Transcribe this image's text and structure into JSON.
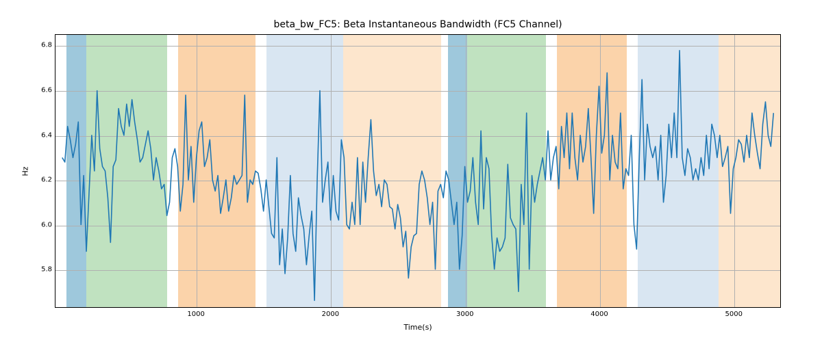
{
  "chart_data": {
    "type": "line",
    "title": "beta_bw_FC5: Beta Instantaneous Bandwidth (FC5 Channel)",
    "xlabel": "Time(s)",
    "ylabel": "Hz",
    "xlim": [
      -50,
      5350
    ],
    "ylim": [
      5.63,
      6.85
    ],
    "xticks": [
      1000,
      2000,
      3000,
      4000,
      5000
    ],
    "yticks": [
      5.8,
      6.0,
      6.2,
      6.4,
      6.6,
      6.8
    ],
    "bands": [
      {
        "x0": 30,
        "x1": 180,
        "color": "#9ec8dc"
      },
      {
        "x0": 180,
        "x1": 780,
        "color": "#c0e2c0"
      },
      {
        "x0": 860,
        "x1": 1440,
        "color": "#fbd3aa"
      },
      {
        "x0": 1520,
        "x1": 2090,
        "color": "#d9e6f2"
      },
      {
        "x0": 2090,
        "x1": 2820,
        "color": "#fde6cd"
      },
      {
        "x0": 2870,
        "x1": 3010,
        "color": "#9ec8dc"
      },
      {
        "x0": 3010,
        "x1": 3600,
        "color": "#c0e2c0"
      },
      {
        "x0": 3680,
        "x1": 4200,
        "color": "#fbd3aa"
      },
      {
        "x0": 4280,
        "x1": 4880,
        "color": "#d9e6f2"
      },
      {
        "x0": 4880,
        "x1": 5350,
        "color": "#fde6cd"
      }
    ],
    "x": [
      0,
      20,
      40,
      60,
      80,
      100,
      120,
      140,
      160,
      180,
      200,
      220,
      240,
      260,
      280,
      300,
      320,
      340,
      360,
      380,
      400,
      420,
      440,
      460,
      480,
      500,
      520,
      540,
      560,
      580,
      600,
      620,
      640,
      660,
      680,
      700,
      720,
      740,
      760,
      780,
      800,
      820,
      840,
      860,
      880,
      900,
      920,
      940,
      960,
      980,
      1000,
      1020,
      1040,
      1060,
      1080,
      1100,
      1120,
      1140,
      1160,
      1180,
      1200,
      1220,
      1240,
      1260,
      1280,
      1300,
      1320,
      1340,
      1360,
      1380,
      1400,
      1420,
      1440,
      1460,
      1480,
      1500,
      1520,
      1540,
      1560,
      1580,
      1600,
      1620,
      1640,
      1660,
      1680,
      1700,
      1720,
      1740,
      1760,
      1780,
      1800,
      1820,
      1840,
      1860,
      1880,
      1900,
      1920,
      1940,
      1960,
      1980,
      2000,
      2020,
      2040,
      2060,
      2080,
      2100,
      2120,
      2140,
      2160,
      2180,
      2200,
      2220,
      2240,
      2260,
      2280,
      2300,
      2320,
      2340,
      2360,
      2380,
      2400,
      2420,
      2440,
      2460,
      2480,
      2500,
      2520,
      2540,
      2560,
      2580,
      2600,
      2620,
      2640,
      2660,
      2680,
      2700,
      2720,
      2740,
      2760,
      2780,
      2800,
      2820,
      2840,
      2860,
      2880,
      2900,
      2920,
      2940,
      2960,
      2980,
      3000,
      3020,
      3040,
      3060,
      3080,
      3100,
      3120,
      3140,
      3160,
      3180,
      3200,
      3220,
      3240,
      3260,
      3280,
      3300,
      3320,
      3340,
      3360,
      3380,
      3400,
      3420,
      3440,
      3460,
      3480,
      3500,
      3520,
      3540,
      3560,
      3580,
      3600,
      3620,
      3640,
      3660,
      3680,
      3700,
      3720,
      3740,
      3760,
      3780,
      3800,
      3820,
      3840,
      3860,
      3880,
      3900,
      3920,
      3940,
      3960,
      3980,
      4000,
      4020,
      4040,
      4060,
      4080,
      4100,
      4120,
      4140,
      4160,
      4180,
      4200,
      4220,
      4240,
      4260,
      4280,
      4300,
      4320,
      4340,
      4360,
      4380,
      4400,
      4420,
      4440,
      4460,
      4480,
      4500,
      4520,
      4540,
      4560,
      4580,
      4600,
      4620,
      4640,
      4660,
      4680,
      4700,
      4720,
      4740,
      4760,
      4780,
      4800,
      4820,
      4840,
      4860,
      4880,
      4900,
      4920,
      4940,
      4960,
      4980,
      5000,
      5020,
      5040,
      5060,
      5080,
      5100,
      5120,
      5140,
      5160,
      5180,
      5200,
      5220,
      5240,
      5260,
      5280,
      5300
    ],
    "y": [
      6.3,
      6.28,
      6.44,
      6.38,
      6.3,
      6.36,
      6.46,
      6.0,
      6.22,
      5.88,
      6.14,
      6.4,
      6.24,
      6.6,
      6.34,
      6.26,
      6.24,
      6.12,
      5.92,
      6.26,
      6.29,
      6.52,
      6.44,
      6.4,
      6.54,
      6.44,
      6.56,
      6.46,
      6.38,
      6.28,
      6.3,
      6.36,
      6.42,
      6.34,
      6.2,
      6.3,
      6.24,
      6.16,
      6.18,
      6.04,
      6.1,
      6.3,
      6.34,
      6.26,
      6.06,
      6.18,
      6.58,
      6.2,
      6.35,
      6.1,
      6.3,
      6.42,
      6.46,
      6.26,
      6.3,
      6.38,
      6.2,
      6.15,
      6.22,
      6.05,
      6.12,
      6.2,
      6.06,
      6.12,
      6.22,
      6.18,
      6.2,
      6.22,
      6.58,
      6.1,
      6.2,
      6.18,
      6.24,
      6.23,
      6.16,
      6.06,
      6.2,
      6.08,
      5.96,
      5.94,
      6.3,
      5.82,
      5.98,
      5.78,
      5.94,
      6.22,
      5.96,
      5.88,
      6.12,
      6.04,
      5.98,
      5.82,
      5.95,
      6.06,
      5.66,
      6.2,
      6.6,
      6.1,
      6.2,
      6.28,
      6.02,
      6.22,
      6.06,
      6.02,
      6.38,
      6.3,
      6.0,
      5.98,
      6.1,
      6.0,
      6.3,
      6.0,
      6.28,
      6.1,
      6.3,
      6.47,
      6.24,
      6.13,
      6.18,
      6.08,
      6.2,
      6.18,
      6.08,
      6.07,
      5.98,
      6.09,
      6.03,
      5.9,
      5.97,
      5.76,
      5.9,
      5.95,
      5.96,
      6.18,
      6.24,
      6.2,
      6.12,
      6.0,
      6.1,
      5.8,
      6.15,
      6.18,
      6.12,
      6.24,
      6.2,
      6.1,
      6.0,
      6.1,
      5.8,
      5.95,
      6.26,
      6.1,
      6.15,
      6.3,
      6.1,
      6.0,
      6.42,
      6.07,
      6.3,
      6.25,
      5.95,
      5.8,
      5.94,
      5.88,
      5.9,
      5.94,
      6.27,
      6.03,
      6.0,
      5.98,
      5.7,
      6.18,
      6.0,
      6.5,
      5.8,
      6.22,
      6.1,
      6.18,
      6.24,
      6.3,
      6.2,
      6.42,
      6.2,
      6.3,
      6.35,
      6.16,
      6.44,
      6.3,
      6.5,
      6.25,
      6.5,
      6.3,
      6.2,
      6.4,
      6.28,
      6.35,
      6.52,
      6.3,
      6.05,
      6.4,
      6.62,
      6.32,
      6.4,
      6.68,
      6.2,
      6.4,
      6.28,
      6.25,
      6.5,
      6.16,
      6.25,
      6.22,
      6.4,
      6.0,
      5.89,
      6.3,
      6.65,
      6.2,
      6.45,
      6.35,
      6.3,
      6.35,
      6.2,
      6.4,
      6.1,
      6.22,
      6.45,
      6.3,
      6.5,
      6.3,
      6.78,
      6.3,
      6.22,
      6.34,
      6.3,
      6.2,
      6.25,
      6.2,
      6.3,
      6.22,
      6.4,
      6.25,
      6.45,
      6.4,
      6.3,
      6.4,
      6.26,
      6.3,
      6.35,
      6.05,
      6.25,
      6.3,
      6.38,
      6.36,
      6.28,
      6.4,
      6.3,
      6.5,
      6.4,
      6.32,
      6.25,
      6.45,
      6.55,
      6.4,
      6.35,
      6.5
    ]
  }
}
